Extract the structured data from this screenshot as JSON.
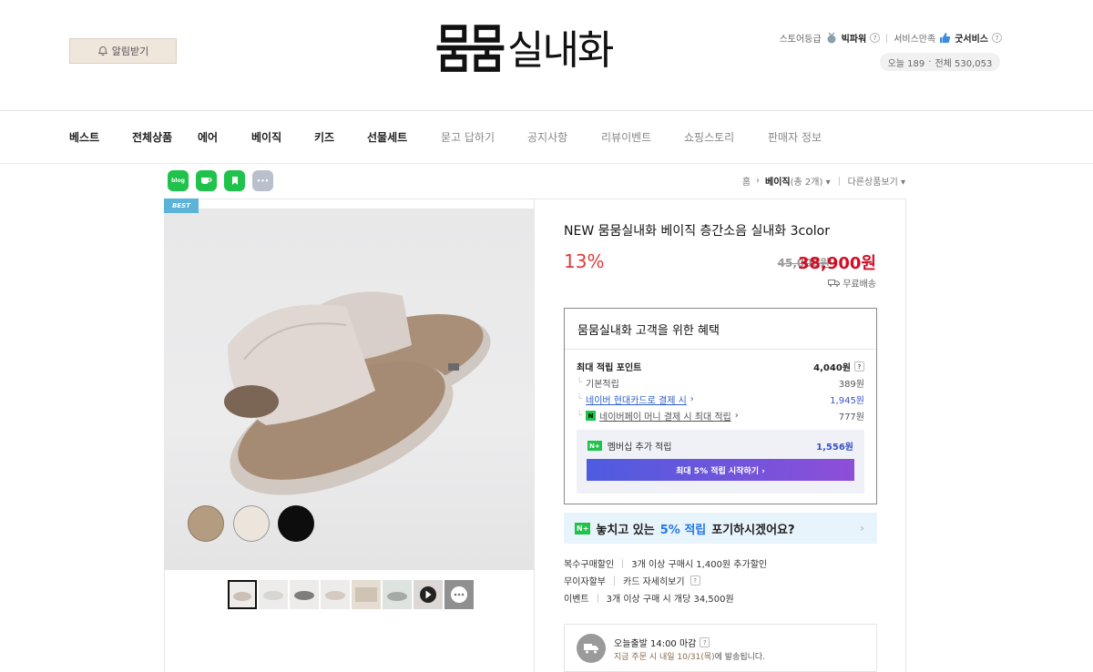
{
  "header": {
    "alarm_label": "알림받기",
    "logo_mark": "뭄뭄",
    "logo_name": "실내화",
    "store_grade_label": "스토어등급",
    "store_grade": "빅파워",
    "service_label": "서비스만족",
    "service_grade": "굿서비스",
    "today_visits": "오늘 189",
    "total_visits": "전체 530,053"
  },
  "nav": [
    {
      "label": "베스트",
      "style": "bold"
    },
    {
      "label": "전체상품",
      "style": "bold"
    },
    {
      "label": "에어",
      "style": "bold"
    },
    {
      "label": "베이직",
      "style": "bold"
    },
    {
      "label": "키즈",
      "style": "bold"
    },
    {
      "label": "선물세트",
      "style": "bold"
    },
    {
      "label": "묻고 답하기",
      "style": "light"
    },
    {
      "label": "공지사항",
      "style": "light"
    },
    {
      "label": "리뷰이벤트",
      "style": "light"
    },
    {
      "label": "쇼핑스토리",
      "style": "light"
    },
    {
      "label": "판매자 정보",
      "style": "light"
    }
  ],
  "share": {
    "blog": "blog",
    "more": "•••"
  },
  "breadcrumb": {
    "home": "홈",
    "category": "베이직",
    "count": "(총 2개)",
    "other": "다른상품보기"
  },
  "product": {
    "badge": "BEST",
    "title": "NEW 뭄뭄실내화 베이직 층간소음 실내화 3color",
    "discount": "13%",
    "original_price": "45,000원",
    "price": "38,900원",
    "shipping": "무료배송",
    "swatch_colors": [
      "#b39c80",
      "#ebe5dc",
      "#0d0d0d"
    ],
    "thumbnail_count": 8
  },
  "benefit": {
    "heading": "뭄뭄실내화 고객을 위한 혜택",
    "max_points_label": "최대 적립 포인트",
    "max_points": "4,040원",
    "basic_label": "기본적립",
    "basic_value": "389원",
    "card_label": "네이버 현대카드로 결제 시",
    "card_value": "1,945원",
    "pay_label": "네이버페이 머니 결제 시 최대 적립",
    "pay_value": "777원",
    "member_label": "멤버십 추가 적립",
    "member_value": "1,556원",
    "member_button": "최대 5% 적립 시작하기 ›"
  },
  "promo": {
    "prefix": "놓치고 있는",
    "highlight": "5% 적립",
    "suffix": "포기하시겠어요?"
  },
  "info": {
    "multi_label": "복수구매할인",
    "multi_value": "3개 이상 구매시 1,400원 추가할인",
    "installment_label": "무이자할부",
    "installment_value": "카드 자세히보기",
    "event_label": "이벤트",
    "event_value": "3개 이상 구매 시 개당 34,500원"
  },
  "delivery": {
    "title": "오늘출발 14:00 마감",
    "highlight": "지금 주문 시 내일 10/31(목)",
    "rest": "에 발송됩니다."
  }
}
